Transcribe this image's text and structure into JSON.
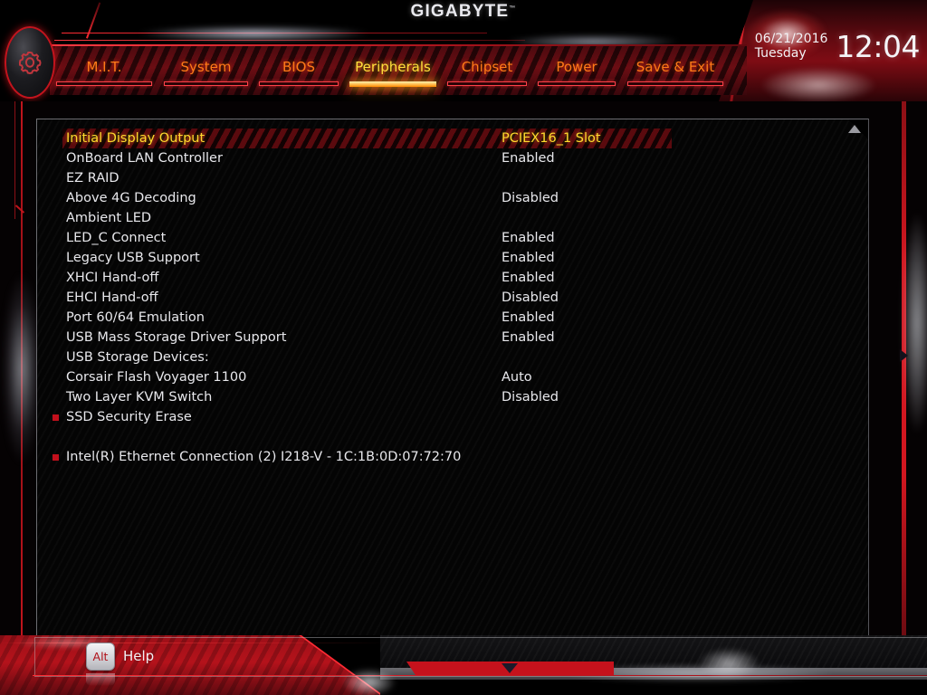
{
  "brand": {
    "logo": "GIGABYTE",
    "trademark": "™"
  },
  "clock": {
    "date": "06/21/2016",
    "weekday": "Tuesday",
    "time": "12:04"
  },
  "nav": {
    "tabs": [
      {
        "label": "M.I.T.",
        "active": false
      },
      {
        "label": "System",
        "active": false
      },
      {
        "label": "BIOS",
        "active": false
      },
      {
        "label": "Peripherals",
        "active": true
      },
      {
        "label": "Chipset",
        "active": false
      },
      {
        "label": "Power",
        "active": false
      },
      {
        "label": "Save & Exit",
        "active": false
      }
    ]
  },
  "settings": {
    "rows": [
      {
        "label": "Initial Display Output",
        "value": "PCIEX16_1 Slot",
        "selected": true,
        "submenu": false
      },
      {
        "label": "OnBoard LAN Controller",
        "value": "Enabled",
        "selected": false,
        "submenu": false
      },
      {
        "label": "EZ RAID",
        "value": "",
        "selected": false,
        "submenu": false
      },
      {
        "label": "Above 4G Decoding",
        "value": "Disabled",
        "selected": false,
        "submenu": false
      },
      {
        "label": "Ambient LED",
        "value": "",
        "selected": false,
        "submenu": false
      },
      {
        "label": "LED_C Connect",
        "value": "Enabled",
        "selected": false,
        "submenu": false
      },
      {
        "label": "Legacy USB Support",
        "value": "Enabled",
        "selected": false,
        "submenu": false
      },
      {
        "label": "XHCI Hand-off",
        "value": "Enabled",
        "selected": false,
        "submenu": false
      },
      {
        "label": "EHCI Hand-off",
        "value": "Disabled",
        "selected": false,
        "submenu": false
      },
      {
        "label": "Port 60/64 Emulation",
        "value": "Enabled",
        "selected": false,
        "submenu": false
      },
      {
        "label": "USB Mass Storage Driver Support",
        "value": "Enabled",
        "selected": false,
        "submenu": false
      },
      {
        "label": "USB Storage Devices:",
        "value": "",
        "selected": false,
        "submenu": false
      },
      {
        "label": "Corsair Flash Voyager 1100",
        "value": "Auto",
        "selected": false,
        "submenu": false
      },
      {
        "label": "Two Layer KVM Switch",
        "value": "Disabled",
        "selected": false,
        "submenu": false
      },
      {
        "label": "SSD Security Erase",
        "value": "",
        "selected": false,
        "submenu": true
      },
      {
        "label": "",
        "value": "",
        "selected": false,
        "submenu": false,
        "spacer": true
      },
      {
        "label": "Intel(R) Ethernet Connection (2) I218-V - 1C:1B:0D:07:72:70",
        "value": "",
        "selected": false,
        "submenu": true
      }
    ]
  },
  "footer": {
    "alt_key": "Alt",
    "help_label": "Help"
  },
  "icons": {
    "gear": "gear-icon",
    "panel_scroll_up": "scroll-up-arrow-icon",
    "panel_scroll_down": "scroll-down-arrow-icon",
    "side_arrow": "right-arrow-icon"
  },
  "colors": {
    "accent_red": "#c5121c",
    "tab_orange": "#ff7a18",
    "tab_active_yellow": "#ffe23d",
    "selected_row_bg": "#5a0a0e",
    "text_primary": "#e8e8ec",
    "submenu_bullet": "#c2101c"
  }
}
